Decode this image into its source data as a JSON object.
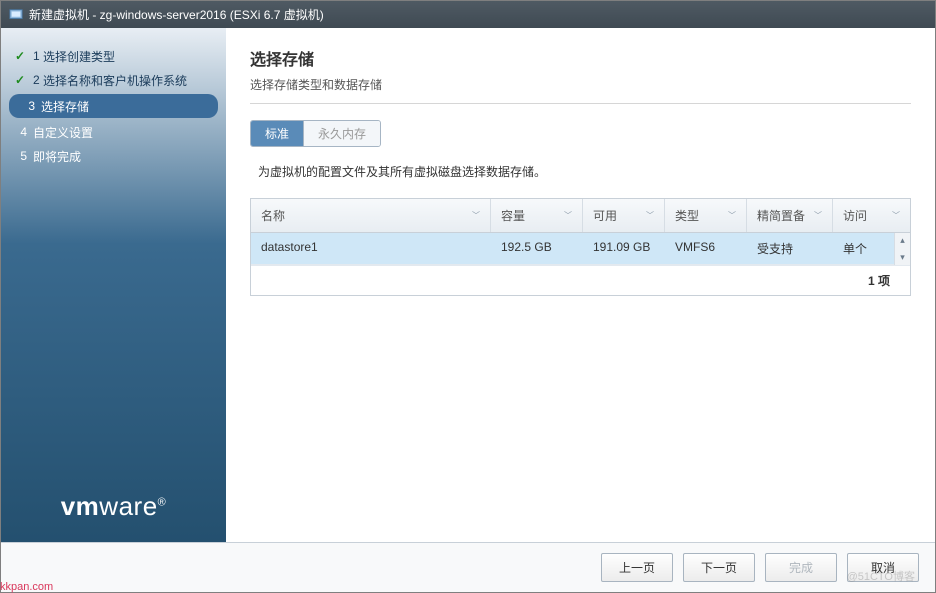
{
  "titlebar": {
    "text": "新建虚拟机 - zg-windows-server2016 (ESXi 6.7 虚拟机)"
  },
  "sidebar": {
    "steps": [
      {
        "num": "1",
        "label": "选择创建类型",
        "state": "done"
      },
      {
        "num": "2",
        "label": "选择名称和客户机操作系统",
        "state": "done"
      },
      {
        "num": "3",
        "label": "选择存储",
        "state": "current"
      },
      {
        "num": "4",
        "label": "自定义设置",
        "state": "pending"
      },
      {
        "num": "5",
        "label": "即将完成",
        "state": "pending"
      }
    ],
    "logo_bold": "vm",
    "logo_rest": "ware"
  },
  "main": {
    "title": "选择存储",
    "subtitle": "选择存储类型和数据存储",
    "tabs": {
      "standard": "标准",
      "persistent": "永久内存"
    },
    "description": "为虚拟机的配置文件及其所有虚拟磁盘选择数据存储。",
    "columns": {
      "name": "名称",
      "capacity": "容量",
      "free": "可用",
      "type": "类型",
      "thin": "精简置备",
      "access": "访问"
    },
    "rows": [
      {
        "name": "datastore1",
        "capacity": "192.5 GB",
        "free": "191.09 GB",
        "type": "VMFS6",
        "thin": "受支持",
        "access": "单个"
      }
    ],
    "footer_count": "1 项"
  },
  "buttons": {
    "prev": "上一页",
    "next": "下一页",
    "finish": "完成",
    "cancel": "取消"
  },
  "watermark": "@51CTO博客",
  "kkpan": "kkpan.com"
}
